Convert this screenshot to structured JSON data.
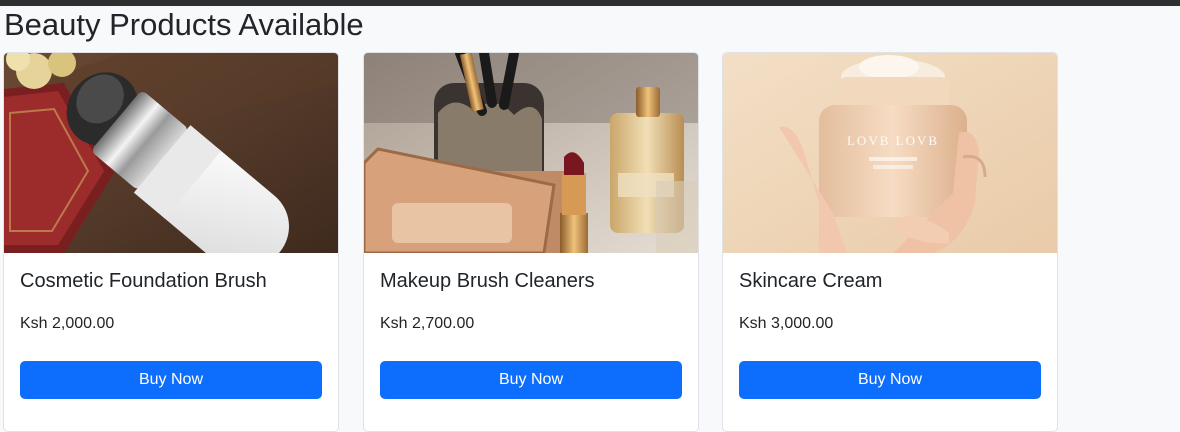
{
  "page": {
    "title": "Beauty Products Available"
  },
  "products": [
    {
      "name": "Cosmetic Foundation Brush",
      "price": "Ksh 2,000.00",
      "button_label": "Buy Now",
      "image_alt": "Cosmetic Foundation Brush"
    },
    {
      "name": "Makeup Brush Cleaners",
      "price": "Ksh 2,700.00",
      "button_label": "Buy Now",
      "image_alt": "Makeup Brush Cleaners"
    },
    {
      "name": "Skincare Cream",
      "price": "Ksh 3,000.00",
      "button_label": "Buy Now",
      "image_alt": "Skincare Cream"
    }
  ],
  "colors": {
    "button": "#0d6efd",
    "background": "#f8f9fa",
    "top_bar": "#2f2f2f"
  },
  "image_text": {
    "jar_brand": "LOVB LOVB"
  }
}
